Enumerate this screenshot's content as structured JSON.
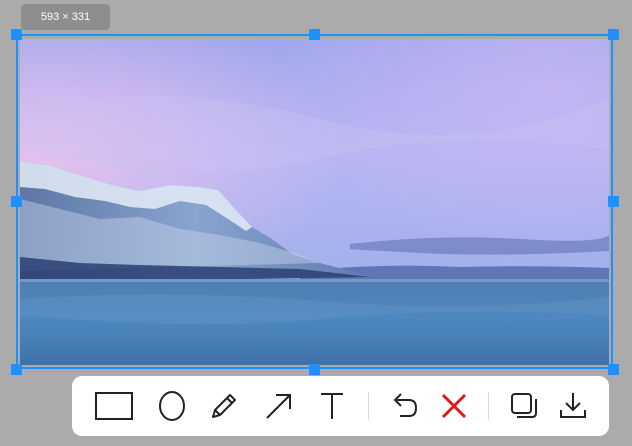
{
  "selection": {
    "size_label": "593 × 331",
    "accent_color": "#1e90ff"
  },
  "image": {
    "content": "photo-snowy-mountain-lake"
  },
  "toolbar": {
    "tools": [
      {
        "icon": "rectangle-icon"
      },
      {
        "icon": "ellipse-icon"
      },
      {
        "icon": "pencil-icon"
      },
      {
        "icon": "arrow-icon"
      },
      {
        "icon": "text-icon"
      },
      {
        "icon": "undo-icon"
      },
      {
        "icon": "close-icon",
        "color": "#e0161b"
      },
      {
        "icon": "copy-icon"
      },
      {
        "icon": "download-icon"
      }
    ]
  }
}
